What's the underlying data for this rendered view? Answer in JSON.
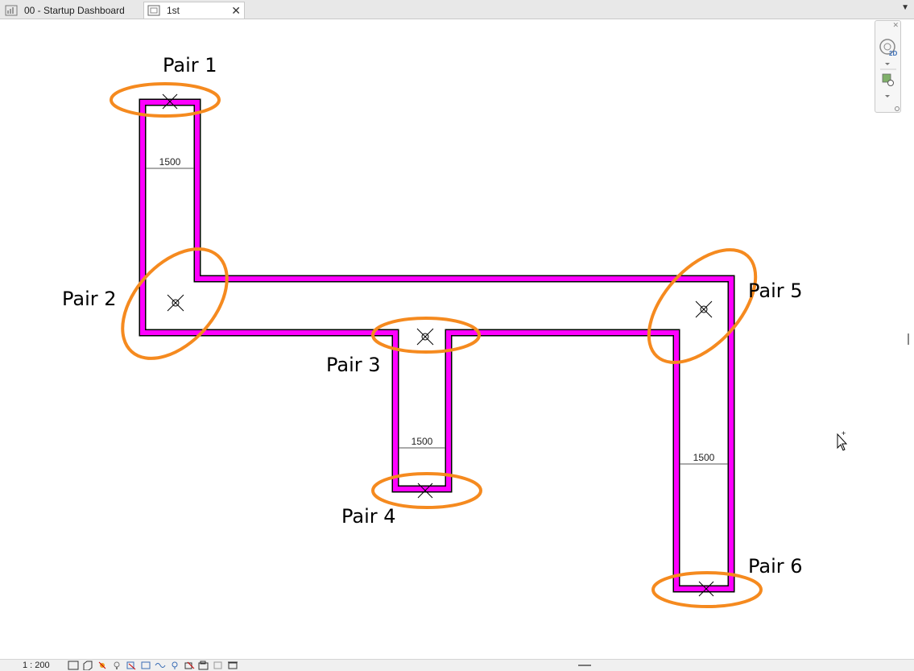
{
  "tabs": [
    {
      "label": "00 - Startup Dashboard",
      "icon": "dashboard-view-icon"
    },
    {
      "label": "1st",
      "icon": "floor-plan-view-icon",
      "active": true
    }
  ],
  "pairs": [
    "Pair 1",
    "Pair 2",
    "Pair 3",
    "Pair 4",
    "Pair 5",
    "Pair 6"
  ],
  "dimensions": [
    "1500",
    "1500",
    "1500"
  ],
  "colors": {
    "duct": "#ff00ff",
    "highlight": "#f58a1f"
  },
  "navbar": {
    "view_mode": "2D"
  },
  "status": {
    "scale": "1 : 200"
  }
}
